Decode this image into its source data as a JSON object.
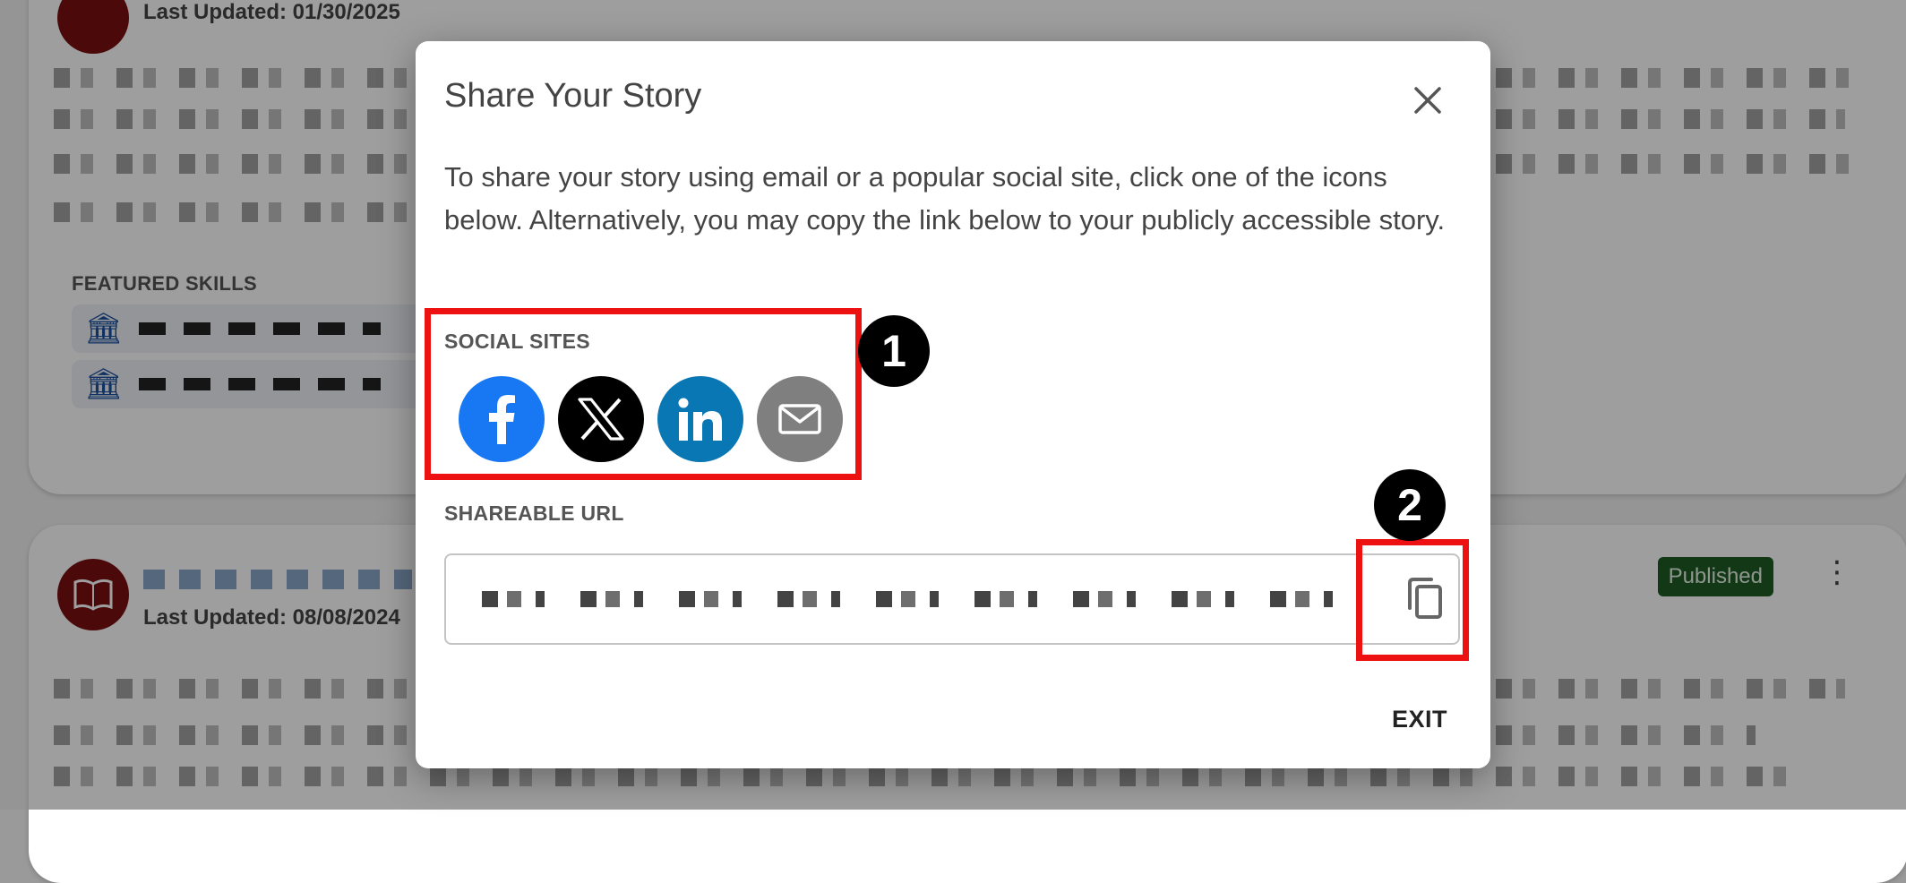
{
  "background": {
    "card1_updated": "Last Updated: 01/30/2025",
    "card2_updated": "Last Updated: 08/08/2024",
    "featured_skills_label": "FEATURED SKILLS",
    "card2_status": "Published"
  },
  "dialog": {
    "title": "Share Your Story",
    "description": "To share your story using email or a popular social site, click one of the icons below. Alternatively, you may copy the link below to your publicly accessible story.",
    "social_label": "SOCIAL SITES",
    "social": [
      {
        "icon": "facebook-icon",
        "color": "#1877f2"
      },
      {
        "icon": "x-icon",
        "color": "#000000"
      },
      {
        "icon": "linkedin-icon",
        "color": "#0a77b5"
      },
      {
        "icon": "email-icon",
        "color": "#7f7f7f"
      }
    ],
    "url_label": "SHAREABLE URL",
    "copy_icon": "copy-icon",
    "exit_label": "EXIT"
  },
  "annotations": {
    "marker_1": "1",
    "marker_2": "2",
    "highlight_color": "#ee1111"
  }
}
